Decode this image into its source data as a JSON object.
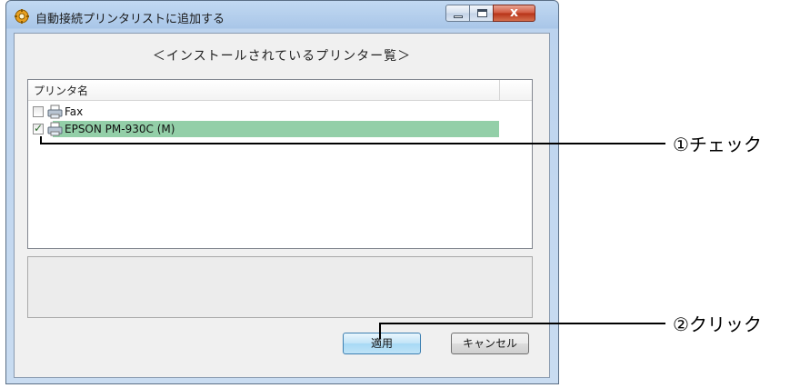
{
  "window": {
    "title": "自動接続プリンタリストに追加する",
    "close_symbol": "x"
  },
  "heading": "＜インストールされているプリンター覧＞",
  "list": {
    "column_header": "プリンタ名",
    "rows": [
      {
        "label": "Fax",
        "checked": false,
        "selected": false,
        "icon": "printer-icon"
      },
      {
        "label": "EPSON PM-930C (M)",
        "checked": true,
        "selected": true,
        "icon": "printer-icon"
      }
    ]
  },
  "buttons": {
    "apply": "適用",
    "cancel": "キャンセル"
  },
  "annotations": {
    "check": "①チェック",
    "click": "②クリック"
  },
  "colors": {
    "selection": "#93cfa8",
    "close_button": "#c7432a",
    "title_bar": "#b6cfec"
  }
}
